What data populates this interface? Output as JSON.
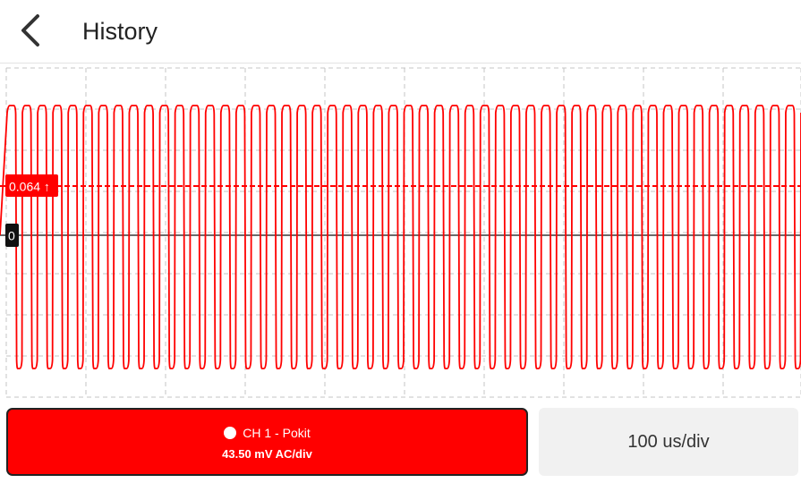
{
  "header": {
    "back_icon": "chevron-left-icon",
    "title": "History"
  },
  "scope": {
    "trigger_label": "0.064 ↑",
    "trigger_color": "#ff0000",
    "zero_label": "0",
    "trace_color": "#ff0000",
    "grid_divisions_horizontal": 10,
    "grid_divisions_vertical": 8,
    "signal_cycles_visible": 52
  },
  "channel": {
    "dot_icon": "channel-dot-icon",
    "name": "CH 1 - Pokit",
    "scale": "43.50 mV AC/div",
    "color": "#ff0000"
  },
  "timebase": {
    "label": "100 us/div"
  }
}
